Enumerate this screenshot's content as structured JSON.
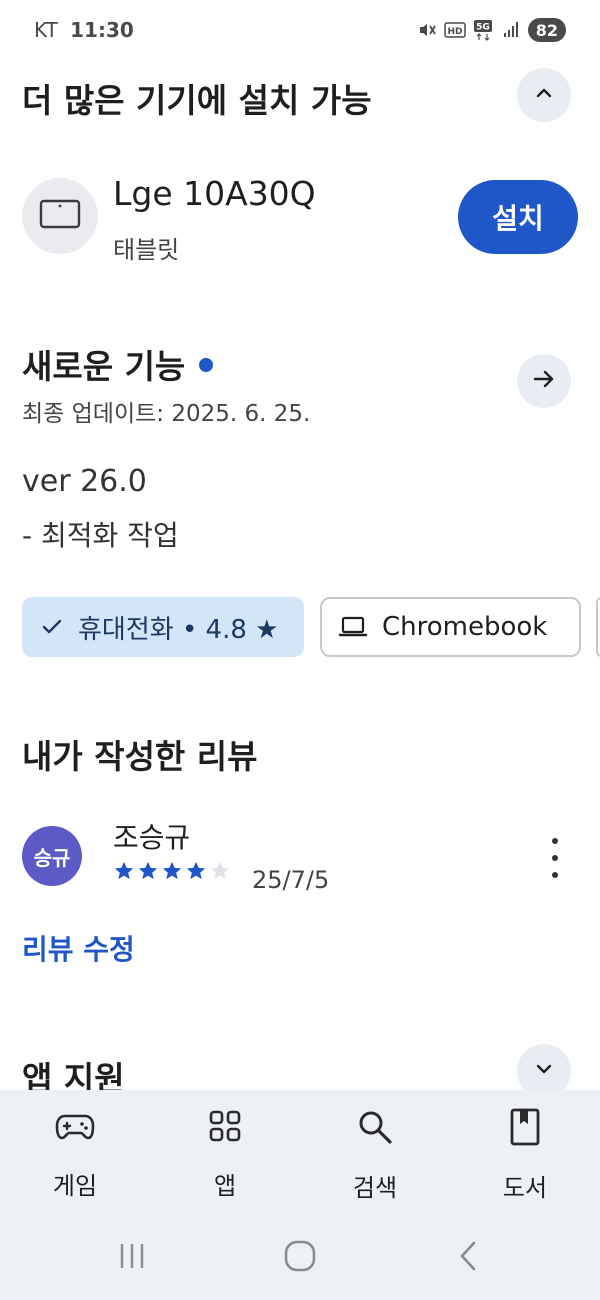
{
  "status_bar": {
    "carrier": "KT",
    "time": "11:30",
    "icons": [
      "mute-icon",
      "hd-icon",
      "5g-icon",
      "signal-icon"
    ],
    "battery": "82"
  },
  "install_more": {
    "title": "더 많은 기기에 설치 가능",
    "collapse_icon": "chevron-up-icon",
    "device_name": "Lge 10A30Q",
    "device_type": "태블릿",
    "install_label": "설치"
  },
  "whats_new": {
    "title": "새로운 기능",
    "updated": "최종 업데이트: 2025. 6. 25.",
    "version": "ver 26.0",
    "notes": "- 최적화 작업"
  },
  "device_chips": [
    {
      "label": "휴대전화 • 4.8 ★",
      "selected": true,
      "icon": "check-icon"
    },
    {
      "label": "Chromebook",
      "selected": false,
      "icon": "laptop-icon"
    }
  ],
  "my_review": {
    "title": "내가 작성한 리뷰",
    "avatar_text": "승규",
    "reviewer": "조승규",
    "rating": 4,
    "max_rating": 5,
    "date": "25/7/5",
    "edit_label": "리뷰 수정"
  },
  "app_support": {
    "title": "앱 지원",
    "expand_icon": "chevron-down-icon"
  },
  "bottom_nav": [
    {
      "label": "게임",
      "icon": "gamepad-icon"
    },
    {
      "label": "앱",
      "icon": "apps-grid-icon"
    },
    {
      "label": "검색",
      "icon": "search-icon"
    },
    {
      "label": "도서",
      "icon": "book-icon"
    }
  ],
  "colors": {
    "accent": "#1f57c8",
    "chip_selected_bg": "#d3e6f7",
    "avatar_bg": "#5b5bc6",
    "nav_bg": "#edf1f6"
  }
}
